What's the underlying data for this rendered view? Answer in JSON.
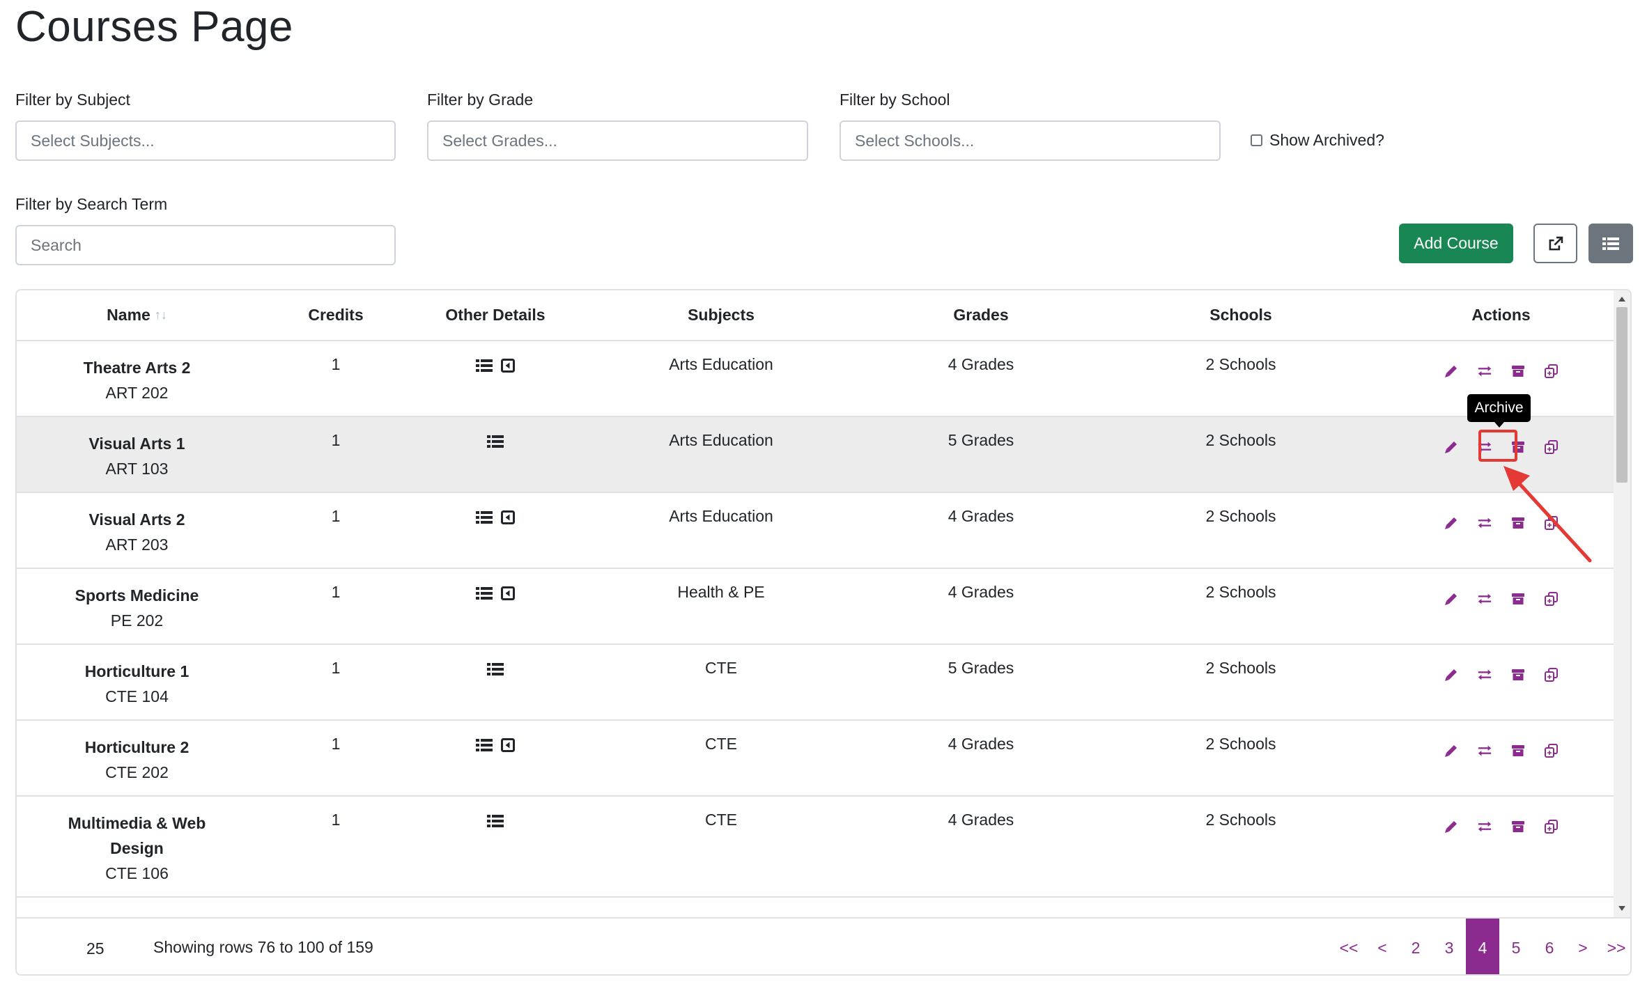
{
  "page": {
    "title": "Courses Page"
  },
  "filters": {
    "subject": {
      "label": "Filter by Subject",
      "placeholder": "Select Subjects..."
    },
    "grade": {
      "label": "Filter by Grade",
      "placeholder": "Select Grades..."
    },
    "school": {
      "label": "Filter by School",
      "placeholder": "Select Schools..."
    },
    "search": {
      "label": "Filter by Search Term",
      "placeholder": "Search"
    },
    "show_archived": {
      "label": "Show Archived?",
      "checked": false
    }
  },
  "toolbar": {
    "add_label": "Add Course",
    "export_icon": "external-link-icon",
    "columns_icon": "list-icon"
  },
  "table": {
    "columns": [
      "Name",
      "Credits",
      "Other Details",
      "Subjects",
      "Grades",
      "Schools",
      "Actions"
    ],
    "rows": [
      {
        "name": "Theatre Arts 2",
        "code": "ART 202",
        "credits": "1",
        "details": [
          "list-icon",
          "caret-left-square-icon"
        ],
        "subjects": "Arts Education",
        "grades": "4 Grades",
        "schools": "2 Schools"
      },
      {
        "name": "Visual Arts 1",
        "code": "ART 103",
        "credits": "1",
        "details": [
          "list-icon"
        ],
        "subjects": "Arts Education",
        "grades": "5 Grades",
        "schools": "2 Schools"
      },
      {
        "name": "Visual Arts 2",
        "code": "ART 203",
        "credits": "1",
        "details": [
          "list-icon",
          "caret-left-square-icon"
        ],
        "subjects": "Arts Education",
        "grades": "4 Grades",
        "schools": "2 Schools"
      },
      {
        "name": "Sports Medicine",
        "code": "PE 202",
        "credits": "1",
        "details": [
          "list-icon",
          "caret-left-square-icon"
        ],
        "subjects": "Health & PE",
        "grades": "4 Grades",
        "schools": "2 Schools"
      },
      {
        "name": "Horticulture 1",
        "code": "CTE 104",
        "credits": "1",
        "details": [
          "list-icon"
        ],
        "subjects": "CTE",
        "grades": "5 Grades",
        "schools": "2 Schools"
      },
      {
        "name": "Horticulture 2",
        "code": "CTE 202",
        "credits": "1",
        "details": [
          "list-icon",
          "caret-left-square-icon"
        ],
        "subjects": "CTE",
        "grades": "4 Grades",
        "schools": "2 Schools"
      },
      {
        "name": "Multimedia & Web Design",
        "code": "CTE 106",
        "credits": "1",
        "details": [
          "list-icon"
        ],
        "subjects": "CTE",
        "grades": "4 Grades",
        "schools": "2 Schools"
      }
    ],
    "actions": [
      "pencil-icon",
      "transfer-icon",
      "archive-icon",
      "copy-icon"
    ],
    "tooltip": "Archive"
  },
  "footer": {
    "page_size": "25",
    "showing": "Showing rows 76 to 100 of 159",
    "pages": [
      "<<",
      "<",
      "2",
      "3",
      "4",
      "5",
      "6",
      ">",
      ">>"
    ],
    "active_page": "4"
  },
  "colors": {
    "accent": "#8b2a8f",
    "primary_btn": "#198754",
    "annotation": "#e53935"
  }
}
